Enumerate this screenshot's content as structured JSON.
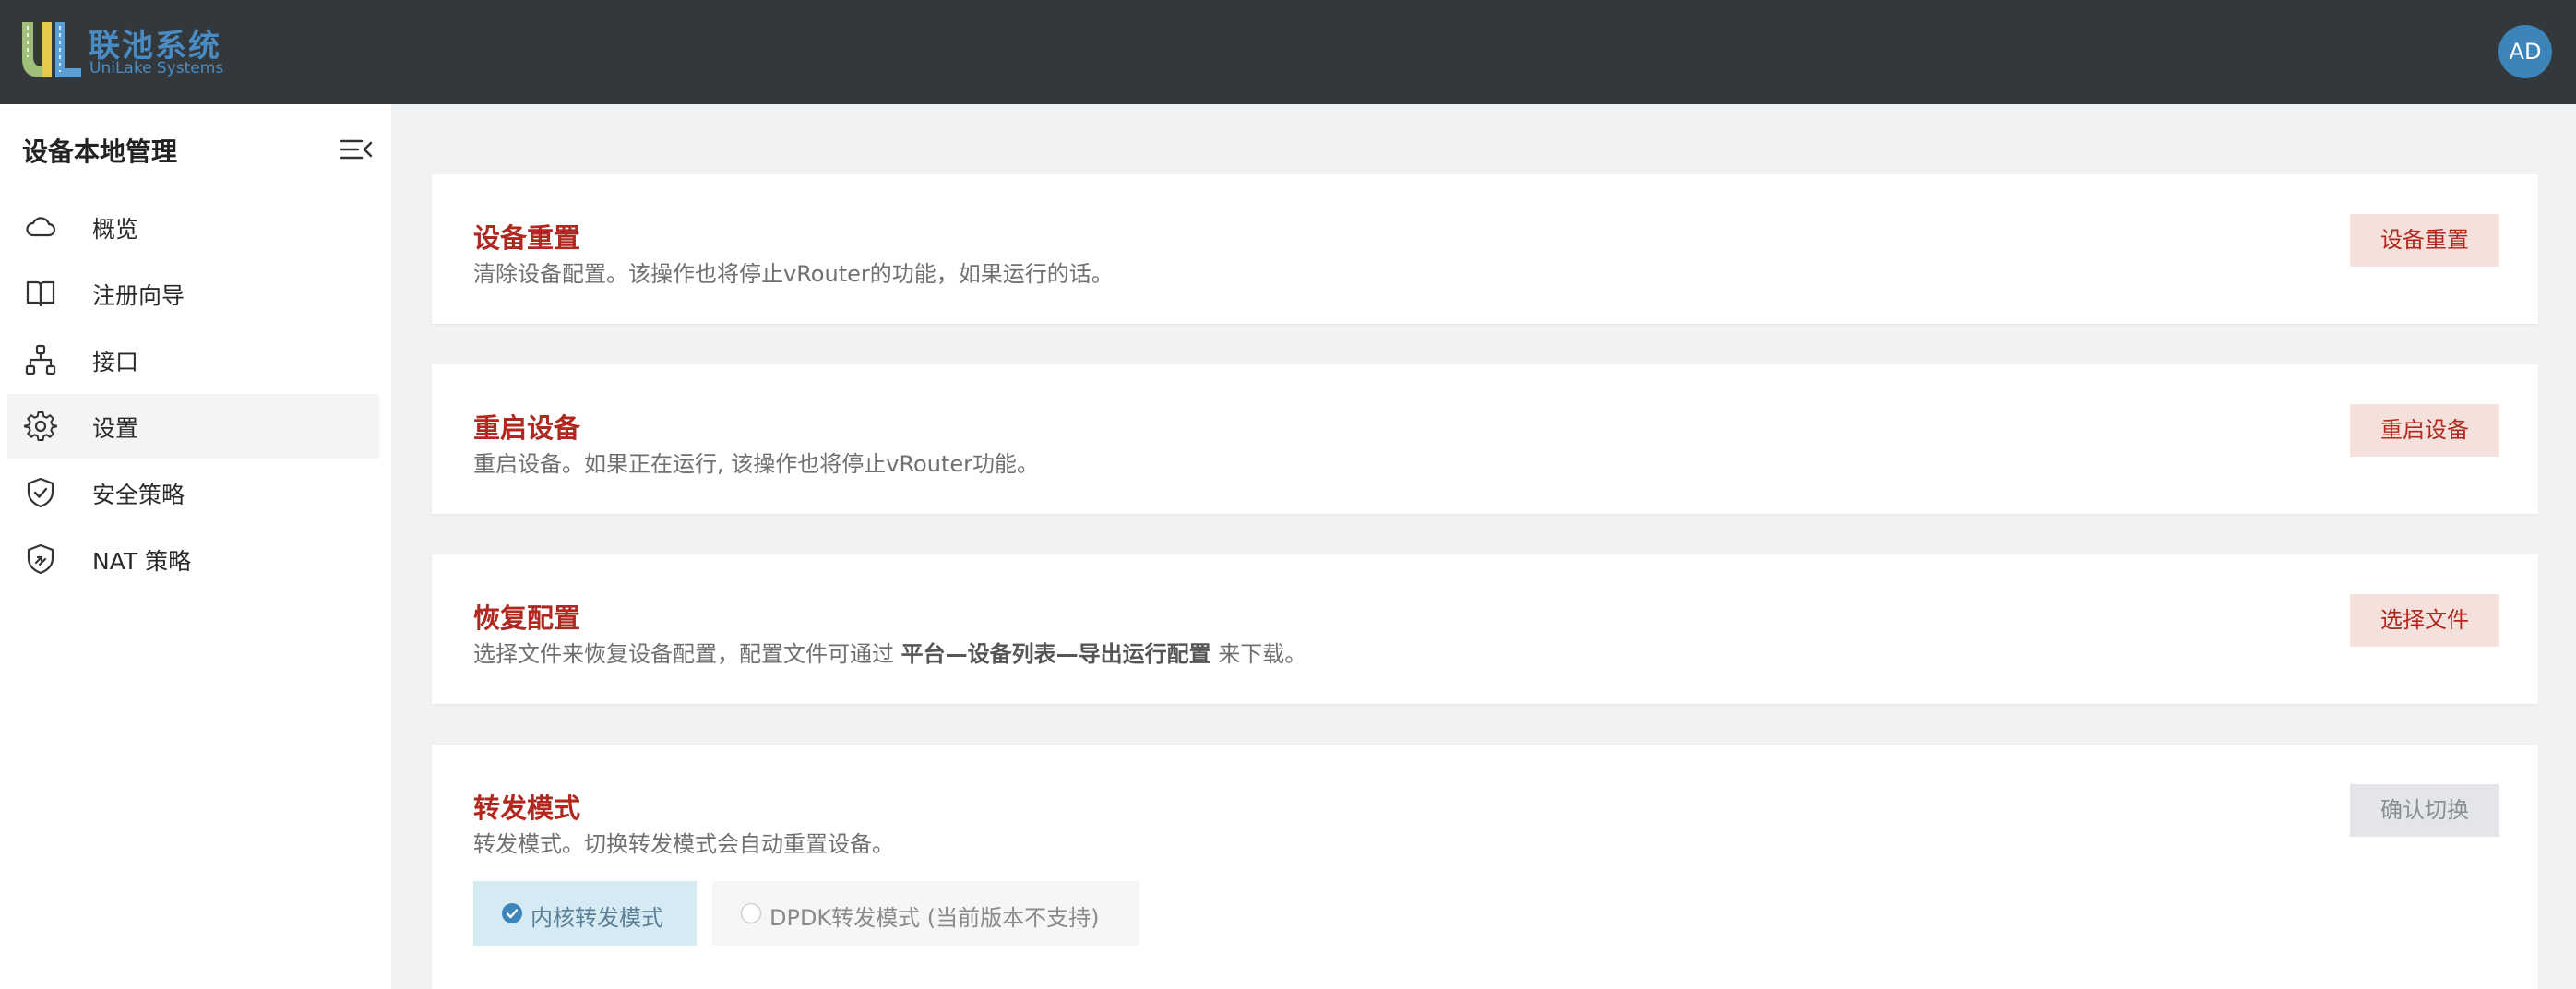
{
  "brand": {
    "name_cn": "联池系统",
    "name_en": "UniLake Systems"
  },
  "user": {
    "initials": "AD"
  },
  "sidebar": {
    "title": "设备本地管理",
    "items": [
      {
        "label": "概览",
        "icon": "cloud-icon"
      },
      {
        "label": "注册向导",
        "icon": "book-icon"
      },
      {
        "label": "接口",
        "icon": "network-icon"
      },
      {
        "label": "设置",
        "icon": "gear-icon",
        "active": true
      },
      {
        "label": "安全策略",
        "icon": "shield-check-icon"
      },
      {
        "label": "NAT 策略",
        "icon": "shield-nat-icon"
      }
    ]
  },
  "cards": {
    "reset": {
      "title": "设备重置",
      "desc": "清除设备配置。该操作也将停止vRouter的功能，如果运行的话。",
      "button": "设备重置"
    },
    "reboot": {
      "title": "重启设备",
      "desc": "重启设备。如果正在运行, 该操作也将停止vRouter功能。",
      "button": "重启设备"
    },
    "restore": {
      "title": "恢复配置",
      "desc_prefix": "选择文件来恢复设备配置，配置文件可通过 ",
      "desc_bold": "平台—设备列表—导出运行配置",
      "desc_suffix": " 来下载。",
      "button": "选择文件"
    },
    "forward": {
      "title": "转发模式",
      "desc": "转发模式。切换转发模式会自动重置设备。",
      "button": "确认切换",
      "options": [
        {
          "label": "内核转发模式",
          "selected": true
        },
        {
          "label": "DPDK转发模式 (当前版本不支持)",
          "selected": false,
          "disabled": true
        }
      ]
    }
  },
  "colors": {
    "header_bg": "#33383d",
    "accent_red": "#b0281f",
    "button_bg": "#f4e1dc",
    "avatar_bg": "#3c84ba",
    "radio_selected_bg": "#d5eaf3",
    "radio_blue": "#3c84ba"
  }
}
